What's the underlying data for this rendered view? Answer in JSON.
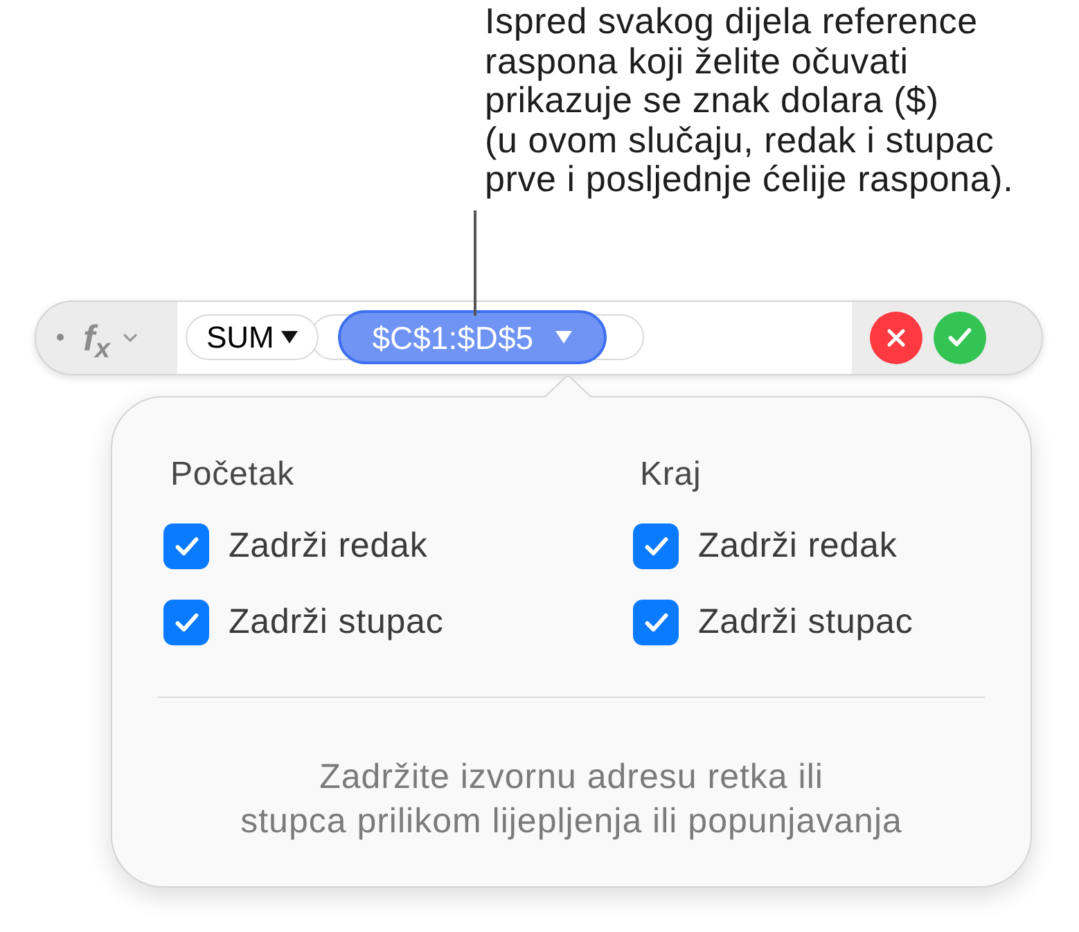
{
  "callout": {
    "text": "Ispred svakog dijela reference\nraspona koji želite očuvati\nprikazuje se znak dolara ($)\n(u ovom slučaju, redak i stupac\nprve i posljednje ćelije raspona)."
  },
  "formula_bar": {
    "function_button": "f$_{x}$",
    "tokens": [
      {
        "kind": "function",
        "label": "SUM"
      },
      {
        "kind": "range",
        "label": "$C$1:$D$5",
        "selected": true
      }
    ]
  },
  "popover": {
    "columns": [
      {
        "heading": "Početak",
        "options": [
          {
            "label": "Zadrži redak",
            "checked": true
          },
          {
            "label": "Zadrži stupac",
            "checked": true
          }
        ]
      },
      {
        "heading": "Kraj",
        "options": [
          {
            "label": "Zadrži redak",
            "checked": true
          },
          {
            "label": "Zadrži stupac",
            "checked": true
          }
        ]
      }
    ],
    "note": "Zadržite izvornu adresu retka ili\nstupca prilikom lijepljenja ili popunjavanja"
  }
}
